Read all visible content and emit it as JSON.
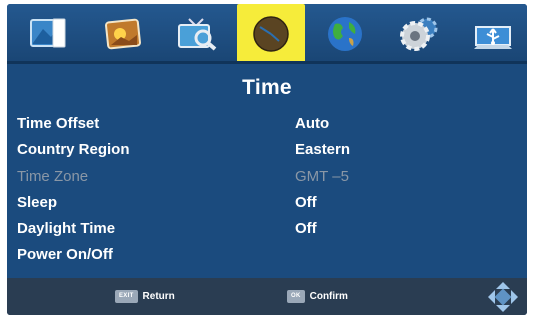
{
  "colors": {
    "panel": "#1b4b7e",
    "active_tab": "#f6ec3a",
    "footer": "#2a3d52",
    "disabled_text": "#8a97a6"
  },
  "tabs": [
    {
      "icon": "picture-icon",
      "active": false
    },
    {
      "icon": "photo-icon",
      "active": false
    },
    {
      "icon": "tv-search-icon",
      "active": false
    },
    {
      "icon": "clock-icon",
      "active": true
    },
    {
      "icon": "globe-icon",
      "active": false
    },
    {
      "icon": "settings-gear-icon",
      "active": false
    },
    {
      "icon": "usb-icon",
      "active": false
    }
  ],
  "page": {
    "title": "Time"
  },
  "settings": [
    {
      "label": "Time Offset",
      "value": "Auto",
      "enabled": true
    },
    {
      "label": "Country Region",
      "value": "Eastern",
      "enabled": true
    },
    {
      "label": "Time Zone",
      "value": "GMT –5",
      "enabled": false
    },
    {
      "label": "Sleep",
      "value": "Off",
      "enabled": true
    },
    {
      "label": "Daylight Time",
      "value": "Off",
      "enabled": true
    },
    {
      "label": "Power On/Off",
      "value": "",
      "enabled": true
    }
  ],
  "footer": {
    "exit_key": "EXIT",
    "return_label": "Return",
    "ok_key": "OK",
    "confirm_label": "Confirm",
    "nav_icon": "dpad-icon"
  }
}
